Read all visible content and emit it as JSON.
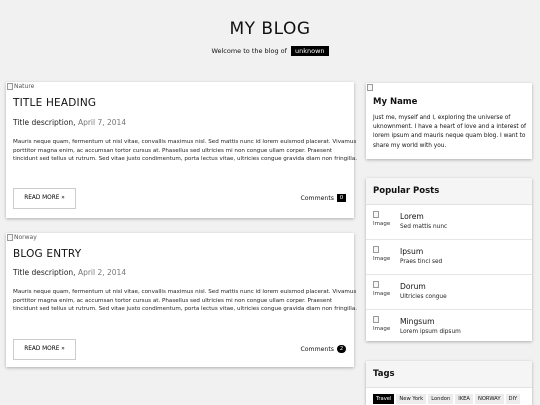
{
  "header": {
    "title": "MY BLOG",
    "welcome_text": "Welcome to the blog of",
    "welcome_tag": "unknown"
  },
  "entries": [
    {
      "image_alt": "Nature",
      "title": "TITLE HEADING",
      "description": "Title description,",
      "date": "April 7, 2014",
      "body": "Mauris neque quam, fermentum ut nisl vitae, convallis maximus nisl. Sed mattis nunc id lorem euismod placerat. Vivamus porttitor magna enim, ac accumsan tortor cursus at. Phasellus sed ultricies mi non congue ullam corper. Praesent tincidunt sed tellus ut rutrum. Sed vitae justo condimentum, porta lectus vitae, ultricies congue gravida diam non fringilla.",
      "read_more": "READ MORE »",
      "comments_label": "Comments",
      "comments_count": "0"
    },
    {
      "image_alt": "Norway",
      "title": "BLOG ENTRY",
      "description": "Title description,",
      "date": "April 2, 2014",
      "body": "Mauris neque quam, fermentum ut nisl vitae, convallis maximus nisl. Sed mattis nunc id lorem euismod placerat. Vivamus porttitor magna enim, ac accumsan tortor cursus at. Phasellus sed ultricies mi non congue ullam corper. Praesent tincidunt sed tellus ut rutrum. Sed vitae justo condimentum, porta lectus vitae, ultricies congue gravida diam non fringilla.",
      "read_more": "READ MORE »",
      "comments_label": "Comments",
      "comments_count": "2"
    }
  ],
  "about": {
    "name": "My Name",
    "body": "Just me, myself and I, exploring the universe of uknownment. I have a heart of love and a interest of lorem ipsum and mauris neque quam blog. I want to share my world with you."
  },
  "popular": {
    "title": "Popular Posts",
    "image_alt": "Image",
    "items": [
      {
        "name": "Lorem",
        "sub": "Sed mattis nunc"
      },
      {
        "name": "Ipsum",
        "sub": "Praes tinci sed"
      },
      {
        "name": "Dorum",
        "sub": "Ultricies congue"
      },
      {
        "name": "Mingsum",
        "sub": "Lorem ipsum dipsum"
      }
    ]
  },
  "tags": {
    "title": "Tags",
    "items": [
      "Travel",
      "New York",
      "London",
      "IKEA",
      "NORWAY",
      "DIY"
    ]
  },
  "colors": {
    "background": "#f1f1f1",
    "accent": "#000000",
    "card": "#ffffff"
  }
}
